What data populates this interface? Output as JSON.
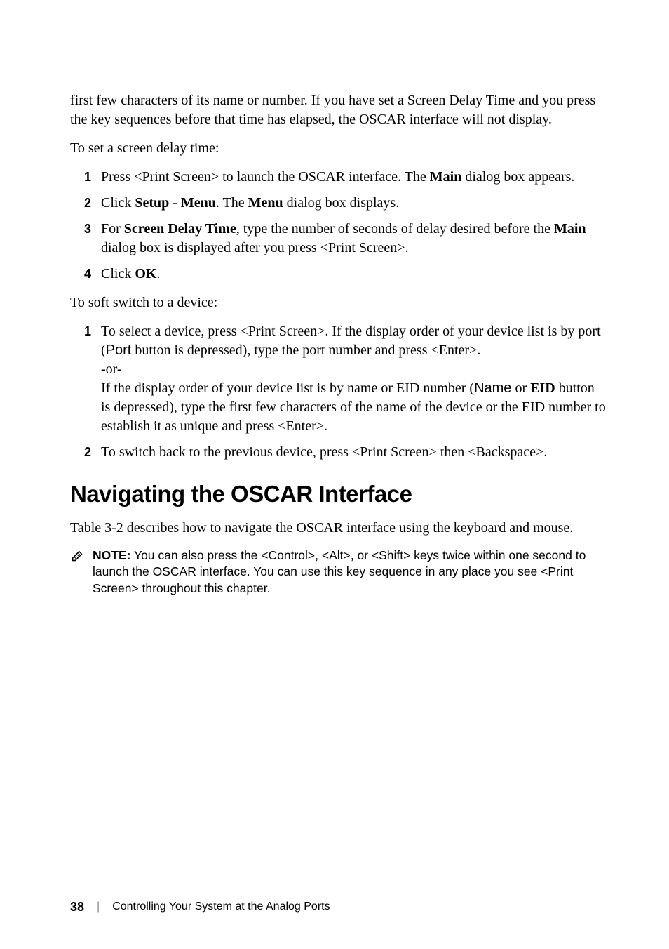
{
  "intro_para": "first few characters of its name or number. If you have set a Screen Delay Time and you press the key sequences before that time has elapsed, the OSCAR interface will not display.",
  "set_delay_intro": "To set a screen delay time:",
  "steps_a": {
    "n1": "1",
    "s1_a": "Press <Print Screen> to launch the OSCAR interface. The ",
    "s1_b": "Main",
    "s1_c": " dialog box appears.",
    "n2": "2",
    "s2_a": "Click ",
    "s2_b": "Setup - Menu",
    "s2_c": ". The ",
    "s2_d": "Menu",
    "s2_e": " dialog box displays.",
    "n3": "3",
    "s3_a": "For ",
    "s3_b": "Screen Delay Time",
    "s3_c": ", type the number of seconds of delay desired before the ",
    "s3_d": "Main",
    "s3_e": " dialog box is displayed after you press <Print Screen>.",
    "n4": "4",
    "s4_a": "Click ",
    "s4_b": "OK",
    "s4_c": "."
  },
  "soft_switch_intro": "To soft switch to a device:",
  "steps_b": {
    "n1": "1",
    "s1_a": "To select a device, press <Print Screen>. If the display order of your device list is by port (",
    "s1_b": "Port",
    "s1_c": " button is depressed), type the port number and press <Enter>.",
    "s1_or": "-or-",
    "s1_d": "If the display order of your device list is by name or EID number (",
    "s1_e": "Name",
    "s1_f": " or ",
    "s1_g": "EID",
    "s1_h": " button is depressed), type the first few characters of the name of the device or the EID number to establish it as unique and press <Enter>.",
    "n2": "2",
    "s2_a": "To switch back to the previous device, press <Print Screen> then <Backspace>."
  },
  "heading": "Navigating the OSCAR Interface",
  "heading_para": "Table 3-2 describes how to navigate the OSCAR interface using the keyboard and mouse.",
  "note_label": "NOTE:",
  "note_text": " You can also press the <Control>, <Alt>, or <Shift> keys twice within one second to launch the OSCAR interface. You can use this key sequence in any place you see <Print Screen> throughout this chapter.",
  "footer": {
    "page": "38",
    "sep": "|",
    "title": "Controlling Your System at the Analog Ports"
  }
}
